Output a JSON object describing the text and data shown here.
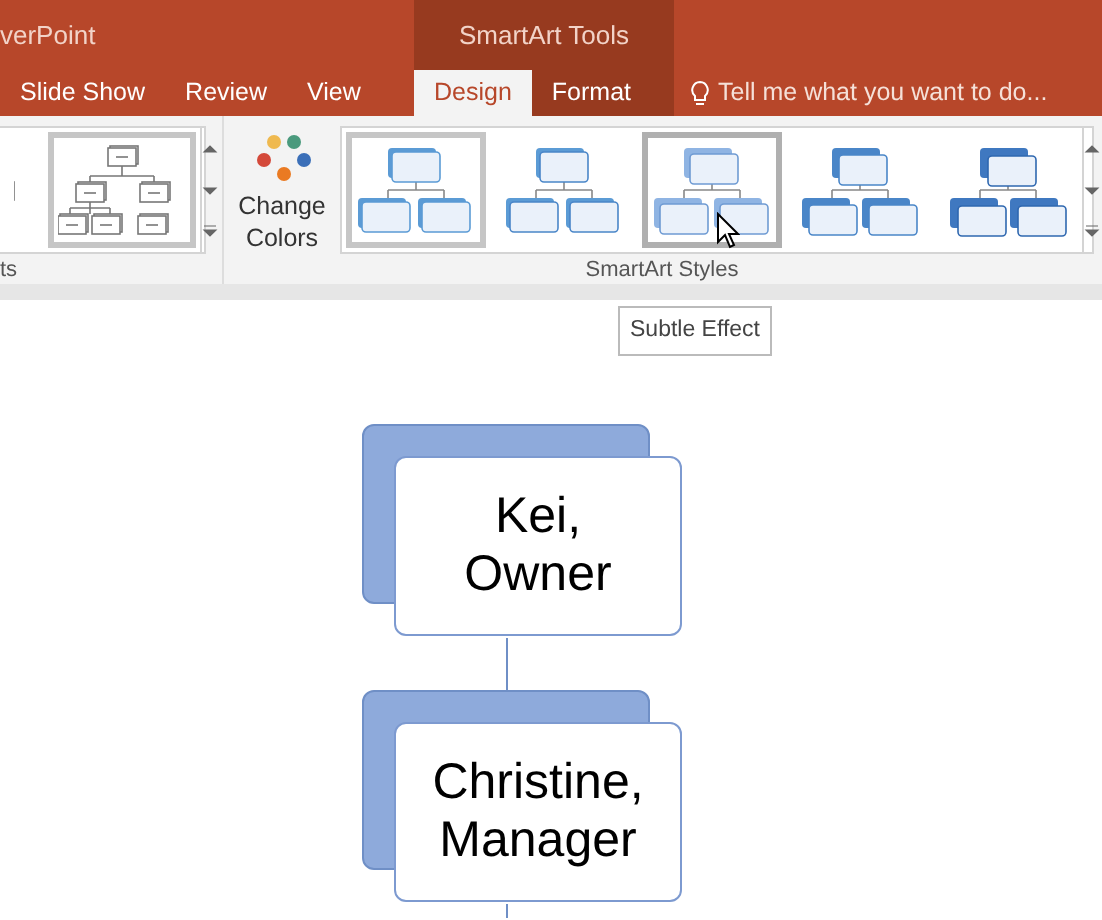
{
  "window": {
    "title": "verPoint"
  },
  "tabs": [
    {
      "label": "Slide Show",
      "selected": false
    },
    {
      "label": "Review",
      "selected": false
    },
    {
      "label": "View",
      "selected": false
    }
  ],
  "contextual_tabs": {
    "title": "SmartArt Tools",
    "tabs": [
      {
        "label": "Design",
        "selected": true
      },
      {
        "label": "Format",
        "selected": false
      }
    ]
  },
  "tell_me": {
    "placeholder": "Tell me what you want to do..."
  },
  "ribbon": {
    "layouts": {
      "group_label": "ts",
      "items": [
        {
          "selected": false
        },
        {
          "selected": true
        }
      ]
    },
    "change_colors": {
      "label": "Change Colors"
    },
    "styles": {
      "group_label": "SmartArt Styles",
      "items": [
        {
          "kind": "simple",
          "selected": true,
          "hovered": false
        },
        {
          "kind": "outline",
          "selected": false,
          "hovered": false
        },
        {
          "kind": "subtle",
          "selected": false,
          "hovered": true
        },
        {
          "kind": "moderate",
          "selected": false,
          "hovered": false
        },
        {
          "kind": "intense",
          "selected": false,
          "hovered": false
        }
      ]
    }
  },
  "tooltip": {
    "text": "Subtle Effect"
  },
  "diagram": {
    "nodes": [
      {
        "text": "Kei,\nOwner"
      },
      {
        "text": "Christine,\nManager"
      }
    ]
  }
}
